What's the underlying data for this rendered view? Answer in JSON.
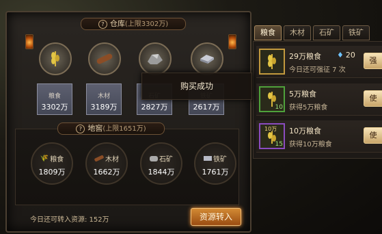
{
  "warehouse": {
    "title": "仓库",
    "limit": "(上限3302万)",
    "slots": [
      {
        "label": "粮食",
        "value": "3302万",
        "icon": "grain-icon"
      },
      {
        "label": "木材",
        "value": "3189万",
        "icon": "wood-icon"
      },
      {
        "label": "石矿",
        "value": "2827万",
        "icon": "stone-icon"
      },
      {
        "label": "铁矿",
        "value": "2617万",
        "icon": "iron-icon"
      }
    ]
  },
  "cellar": {
    "title": "地窖",
    "limit": "(上限1651万)",
    "slots": [
      {
        "label": "粮食",
        "value": "1809万",
        "icon": "grain-icon"
      },
      {
        "label": "木材",
        "value": "1662万",
        "icon": "wood-icon"
      },
      {
        "label": "石矿",
        "value": "1844万",
        "icon": "stone-icon"
      },
      {
        "label": "铁矿",
        "value": "1761万",
        "icon": "iron-icon"
      }
    ]
  },
  "transfer": {
    "remaining_text": "今日还可转入资源: 152万",
    "button_label": "资源转入"
  },
  "tabs": [
    "粮食",
    "木材",
    "石矿",
    "铁矿"
  ],
  "items": [
    {
      "name": "29万粮食",
      "desc": "今日还可强征 7 次",
      "button": "强",
      "diamond_cost": "20",
      "count": "",
      "rarity": "gold"
    },
    {
      "name": "5万粮食",
      "desc": "获得5万粮食",
      "button": "使",
      "count": "10",
      "rarity": "green"
    },
    {
      "name": "10万粮食",
      "desc": "获得10万粮食",
      "button": "使",
      "count": "15",
      "icon_text": "10万",
      "rarity": "purple"
    }
  ],
  "toast": "购买成功",
  "help_glyph": "?"
}
